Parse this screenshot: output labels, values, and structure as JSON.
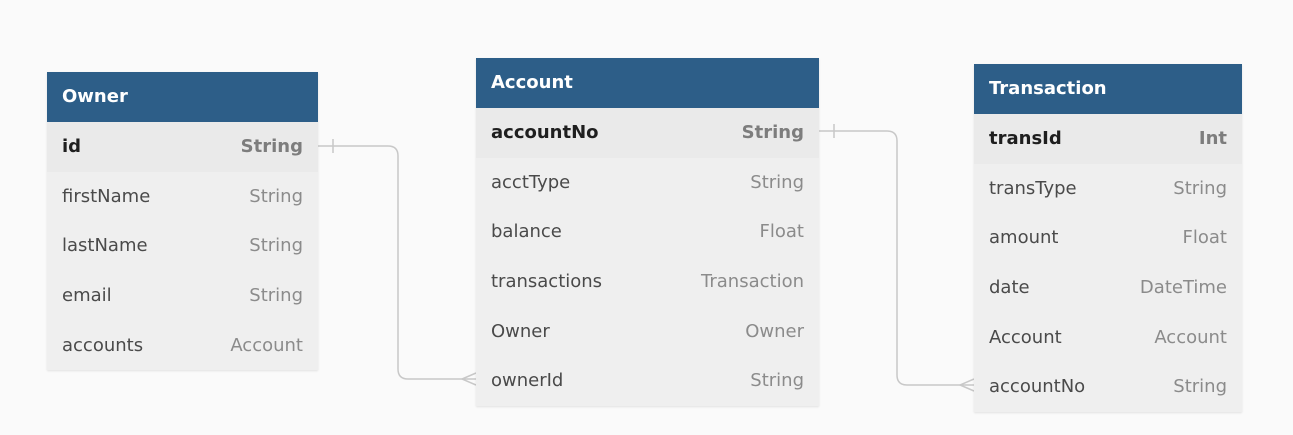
{
  "tables": [
    {
      "name": "Owner",
      "fields": [
        {
          "name": "id",
          "type": "String"
        },
        {
          "name": "firstName",
          "type": "String"
        },
        {
          "name": "lastName",
          "type": "String"
        },
        {
          "name": "email",
          "type": "String"
        },
        {
          "name": "accounts",
          "type": "Account"
        }
      ]
    },
    {
      "name": "Account",
      "fields": [
        {
          "name": "accountNo",
          "type": "String"
        },
        {
          "name": "acctType",
          "type": "String"
        },
        {
          "name": "balance",
          "type": "Float"
        },
        {
          "name": "transactions",
          "type": "Transaction"
        },
        {
          "name": "Owner",
          "type": "Owner"
        },
        {
          "name": "ownerId",
          "type": "String"
        }
      ]
    },
    {
      "name": "Transaction",
      "fields": [
        {
          "name": "transId",
          "type": "Int"
        },
        {
          "name": "transType",
          "type": "String"
        },
        {
          "name": "amount",
          "type": "Float"
        },
        {
          "name": "date",
          "type": "DateTime"
        },
        {
          "name": "Account",
          "type": "Account"
        },
        {
          "name": "accountNo",
          "type": "String"
        }
      ]
    }
  ],
  "relations": [
    {
      "from": "Owner.id",
      "from_cardinality": "one",
      "to": "Account.ownerId",
      "to_cardinality": "many"
    },
    {
      "from": "Account.accountNo",
      "from_cardinality": "one",
      "to": "Transaction.accountNo",
      "to_cardinality": "many"
    }
  ],
  "colors": {
    "header_bg": "#2d5e88",
    "header_text": "#ffffff",
    "table_bg": "#efefef",
    "connector": "#c8c8c8",
    "canvas_bg": "#fafafa"
  }
}
